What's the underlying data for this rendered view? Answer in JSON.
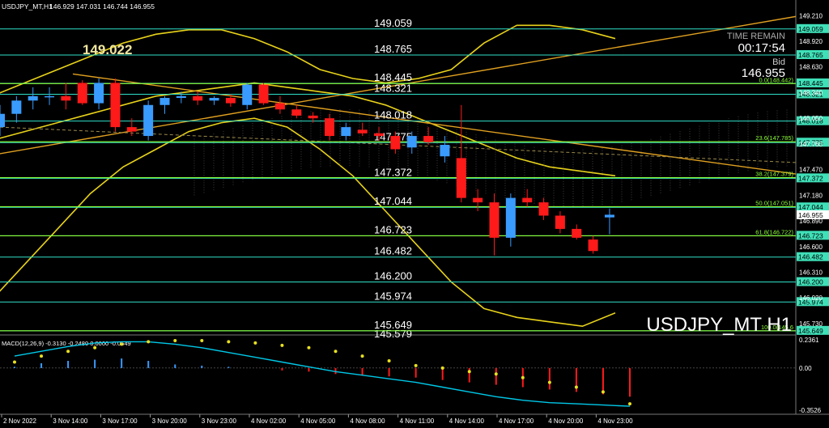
{
  "header": {
    "symbol_info": "USDJPY_MT,H1",
    "ohlc": "146.929 147.031 146.744 146.955"
  },
  "big_price": "149.022",
  "time_remain": {
    "label": "TIME REMAIN",
    "value": "00:17:54"
  },
  "bid": {
    "label": "Bid",
    "value": "146.955"
  },
  "watermark": "USDJPY_MT H1",
  "colors": {
    "background": "#000000",
    "bull": "#3a9bff",
    "bear": "#ff1a1a",
    "band": "#e8d21a",
    "level_line": "#2fe0c8",
    "fib_line": "#8cff3a",
    "trend_line": "#e0a020",
    "macd_line": "#00c8e8",
    "macd_signal": "#e8e020",
    "price_tag_bg": "#3fe0b8",
    "current_tag_bg": "#ffffff"
  },
  "chart_data": {
    "type": "candlestick",
    "symbol": "USDJPY_MT",
    "timeframe": "H1",
    "ylim": [
      145.62,
      149.24
    ],
    "price_axis_ticks": [
      "149.210",
      "148.920",
      "148.630",
      "148.340",
      "148.050",
      "147.760",
      "147.470",
      "147.180",
      "146.890",
      "146.600",
      "146.310",
      "146.020",
      "145.730"
    ],
    "time_labels": [
      "2 Nov 2022",
      "3 Nov 14:00",
      "3 Nov 17:00",
      "3 Nov 20:00",
      "3 Nov 23:00",
      "4 Nov 02:00",
      "4 Nov 05:00",
      "4 Nov 08:00",
      "4 Nov 11:00",
      "4 Nov 14:00",
      "4 Nov 17:00",
      "4 Nov 20:00",
      "4 Nov 23:00"
    ],
    "candles": [
      {
        "o": 147.95,
        "h": 148.2,
        "l": 147.85,
        "c": 148.1
      },
      {
        "o": 148.1,
        "h": 148.3,
        "l": 148.0,
        "c": 148.25
      },
      {
        "o": 148.25,
        "h": 148.4,
        "l": 148.15,
        "c": 148.3
      },
      {
        "o": 148.3,
        "h": 148.4,
        "l": 148.2,
        "c": 148.3
      },
      {
        "o": 148.3,
        "h": 148.45,
        "l": 148.15,
        "c": 148.25
      },
      {
        "o": 148.45,
        "h": 148.48,
        "l": 148.2,
        "c": 148.22
      },
      {
        "o": 148.22,
        "h": 148.5,
        "l": 148.15,
        "c": 148.45
      },
      {
        "o": 148.45,
        "h": 148.5,
        "l": 147.9,
        "c": 147.95
      },
      {
        "o": 147.95,
        "h": 148.05,
        "l": 147.85,
        "c": 147.9
      },
      {
        "o": 147.85,
        "h": 148.25,
        "l": 147.8,
        "c": 148.2
      },
      {
        "o": 148.2,
        "h": 148.3,
        "l": 148.1,
        "c": 148.28
      },
      {
        "o": 148.28,
        "h": 148.35,
        "l": 148.22,
        "c": 148.3
      },
      {
        "o": 148.3,
        "h": 148.35,
        "l": 148.2,
        "c": 148.25
      },
      {
        "o": 148.25,
        "h": 148.3,
        "l": 148.2,
        "c": 148.28
      },
      {
        "o": 148.28,
        "h": 148.32,
        "l": 148.18,
        "c": 148.22
      },
      {
        "o": 148.2,
        "h": 148.45,
        "l": 148.15,
        "c": 148.43
      },
      {
        "o": 148.43,
        "h": 148.45,
        "l": 148.2,
        "c": 148.22
      },
      {
        "o": 148.22,
        "h": 148.3,
        "l": 148.1,
        "c": 148.15
      },
      {
        "o": 148.15,
        "h": 148.2,
        "l": 148.05,
        "c": 148.08
      },
      {
        "o": 148.08,
        "h": 148.12,
        "l": 148.0,
        "c": 148.05
      },
      {
        "o": 148.05,
        "h": 148.1,
        "l": 147.8,
        "c": 147.85
      },
      {
        "o": 147.85,
        "h": 148.0,
        "l": 147.8,
        "c": 147.95
      },
      {
        "o": 147.92,
        "h": 148.0,
        "l": 147.85,
        "c": 147.88
      },
      {
        "o": 147.88,
        "h": 147.95,
        "l": 147.8,
        "c": 147.85
      },
      {
        "o": 147.85,
        "h": 147.9,
        "l": 147.65,
        "c": 147.7
      },
      {
        "o": 147.72,
        "h": 147.9,
        "l": 147.65,
        "c": 147.85
      },
      {
        "o": 147.85,
        "h": 147.95,
        "l": 147.75,
        "c": 147.78
      },
      {
        "o": 147.62,
        "h": 147.85,
        "l": 147.55,
        "c": 147.75
      },
      {
        "o": 147.6,
        "h": 148.2,
        "l": 147.1,
        "c": 147.15
      },
      {
        "o": 147.15,
        "h": 147.25,
        "l": 147.0,
        "c": 147.1
      },
      {
        "o": 147.1,
        "h": 147.2,
        "l": 146.5,
        "c": 146.7
      },
      {
        "o": 146.7,
        "h": 147.2,
        "l": 146.6,
        "c": 147.15
      },
      {
        "o": 147.15,
        "h": 147.25,
        "l": 147.05,
        "c": 147.1
      },
      {
        "o": 147.1,
        "h": 147.15,
        "l": 146.9,
        "c": 146.95
      },
      {
        "o": 146.95,
        "h": 147.0,
        "l": 146.75,
        "c": 146.8
      },
      {
        "o": 146.8,
        "h": 146.85,
        "l": 146.68,
        "c": 146.7
      },
      {
        "o": 146.68,
        "h": 146.72,
        "l": 146.52,
        "c": 146.55
      },
      {
        "o": 146.93,
        "h": 147.03,
        "l": 146.74,
        "c": 146.96
      }
    ],
    "bollinger": {
      "upper": [
        148.3,
        148.45,
        148.6,
        148.75,
        148.9,
        149.0,
        149.05,
        149.05,
        148.95,
        148.8,
        148.6,
        148.5,
        148.45,
        148.5,
        148.6,
        148.9,
        149.1,
        149.1,
        149.05,
        148.95
      ],
      "middle": [
        147.8,
        147.9,
        148.0,
        148.1,
        148.2,
        148.3,
        148.35,
        148.4,
        148.45,
        148.4,
        148.35,
        148.3,
        148.2,
        148.05,
        147.9,
        147.75,
        147.6,
        147.5,
        147.45,
        147.4
      ],
      "lower": [
        146.0,
        146.4,
        146.8,
        147.2,
        147.5,
        147.7,
        147.9,
        148.0,
        148.05,
        147.95,
        147.7,
        147.4,
        147.0,
        146.6,
        146.2,
        145.9,
        145.8,
        145.75,
        145.7,
        145.85
      ]
    },
    "level_lines": [
      149.059,
      148.765,
      148.445,
      148.321,
      148.018,
      147.775,
      147.372,
      147.044,
      146.723,
      146.482,
      146.2,
      145.974,
      145.649
    ],
    "fib_levels": [
      {
        "label": "0.0(148.442)",
        "price": 148.442
      },
      {
        "label": "23.6(147.785)",
        "price": 147.785
      },
      {
        "label": "38.2(147.379)",
        "price": 147.379
      },
      {
        "label": "50.0(147.051)",
        "price": 147.051
      },
      {
        "label": "61.8(146.722)",
        "price": 146.722
      },
      {
        "label": "100.0(145.6",
        "price": 145.649
      }
    ],
    "extra_level_text": "145.579",
    "current_price": 146.955,
    "macd": {
      "label": "MACD(12,26,9) -0.3130 -0.2480 0.0000 -0.0649",
      "ylim": [
        -0.36,
        0.25
      ],
      "axis_ticks": [
        "0.2361",
        "0.00",
        "-0.3526"
      ],
      "histogram": [
        0.01,
        0.04,
        0.06,
        0.07,
        0.08,
        0.06,
        0.03,
        0.02,
        0.01,
        0.0,
        -0.02,
        -0.03,
        -0.05,
        -0.06,
        -0.07,
        -0.08,
        -0.1,
        -0.12,
        -0.14,
        -0.16,
        -0.18,
        -0.2,
        -0.22,
        -0.24
      ],
      "signal": [
        0.05,
        0.1,
        0.14,
        0.17,
        0.2,
        0.22,
        0.23,
        0.23,
        0.22,
        0.21,
        0.19,
        0.17,
        0.14,
        0.1,
        0.06,
        0.02,
        0.0,
        -0.03,
        -0.05,
        -0.08,
        -0.12,
        -0.16,
        -0.2,
        -0.3
      ],
      "macd_line": [
        0.1,
        0.14,
        0.18,
        0.21,
        0.22,
        0.22,
        0.2,
        0.17,
        0.13,
        0.09,
        0.05,
        0.01,
        -0.03,
        -0.06,
        -0.09,
        -0.12,
        -0.16,
        -0.2,
        -0.24,
        -0.27,
        -0.29,
        -0.3,
        -0.31,
        -0.32
      ]
    }
  }
}
